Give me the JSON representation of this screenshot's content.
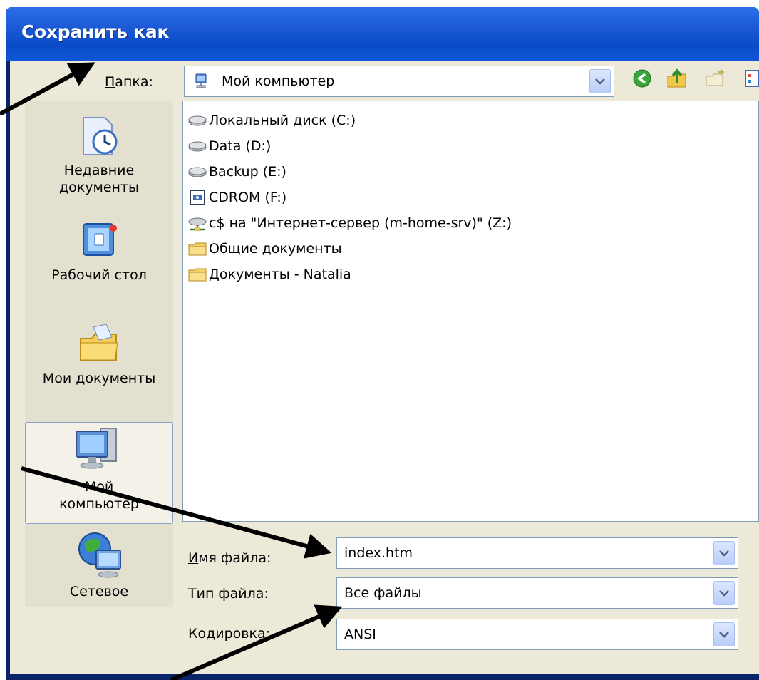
{
  "window": {
    "title": "Сохранить как"
  },
  "folder_row": {
    "label": "Папка:",
    "value": "Мой компьютер"
  },
  "places": [
    {
      "label_lines": [
        "Недавние",
        "документы"
      ]
    },
    {
      "label_lines": [
        "Рабочий стол"
      ]
    },
    {
      "label_lines": [
        "Мои документы"
      ]
    },
    {
      "label_lines": [
        "Мой",
        "компьютер"
      ],
      "selected": true
    },
    {
      "label_lines": [
        "Сетевое"
      ]
    }
  ],
  "files": [
    {
      "name": "Локальный диск (C:)",
      "icon": "hard-drive-icon"
    },
    {
      "name": "Data (D:)",
      "icon": "hard-drive-icon"
    },
    {
      "name": "Backup (E:)",
      "icon": "hard-drive-icon"
    },
    {
      "name": "CDROM (F:)",
      "icon": "cdrom-icon"
    },
    {
      "name": "c$ на \"Интернет-сервер (m-home-srv)\" (Z:)",
      "icon": "network-drive-icon"
    },
    {
      "name": "Общие документы",
      "icon": "folder-icon"
    },
    {
      "name": "Документы - Natalia",
      "icon": "folder-icon"
    }
  ],
  "form": {
    "filename_label": "Имя файла:",
    "filename_value": "index.htm",
    "filetype_label": "Тип файла:",
    "filetype_value": "Все файлы",
    "encoding_label": "Кодировка:",
    "encoding_value": "ANSI"
  },
  "colors": {
    "title_bar": "#0a4bc8",
    "dialog_bg": "#ece9d8",
    "annotation_arrow": "#000000"
  }
}
